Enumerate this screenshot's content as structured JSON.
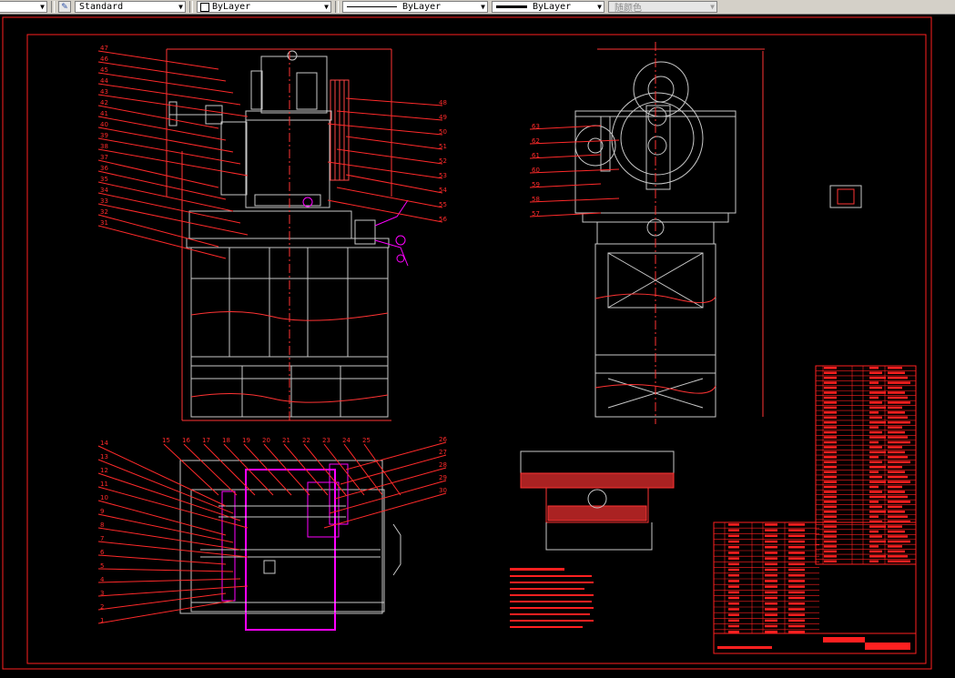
{
  "toolbar": {
    "textstyle_icon": "textstyle-icon",
    "textstyle_value": "Standard",
    "layer_value": "ByLayer",
    "linetype_value": "ByLayer",
    "lineweight_value": "ByLayer",
    "plotstyle_value": "随颜色"
  },
  "colors": {
    "background": "#000000",
    "border": "#ff2020",
    "geometry": "#c8c8c8",
    "leader": "#ff2a2a",
    "highlight": "#ff00ff",
    "hatch": "#ff3333"
  },
  "balloons_top_left": [
    "47",
    "46",
    "45",
    "44",
    "43",
    "42",
    "41",
    "40",
    "39",
    "38",
    "37",
    "36",
    "35",
    "34",
    "33",
    "32",
    "31"
  ],
  "balloons_top_right": [
    "48",
    "49",
    "50",
    "51",
    "52",
    "53",
    "54",
    "55",
    "56"
  ],
  "balloons_side": [
    "63",
    "62",
    "61",
    "60",
    "59",
    "58",
    "57"
  ],
  "balloons_bottom_left": [
    "14",
    "13",
    "12",
    "11",
    "10",
    "9",
    "8",
    "7",
    "6",
    "5",
    "4",
    "3",
    "2",
    "1"
  ],
  "balloons_bottom_top": [
    "15",
    "16",
    "17",
    "18",
    "19",
    "20",
    "21",
    "22",
    "23",
    "24",
    "25"
  ],
  "balloons_bottom_right": [
    "26",
    "27",
    "28",
    "29",
    "30"
  ]
}
